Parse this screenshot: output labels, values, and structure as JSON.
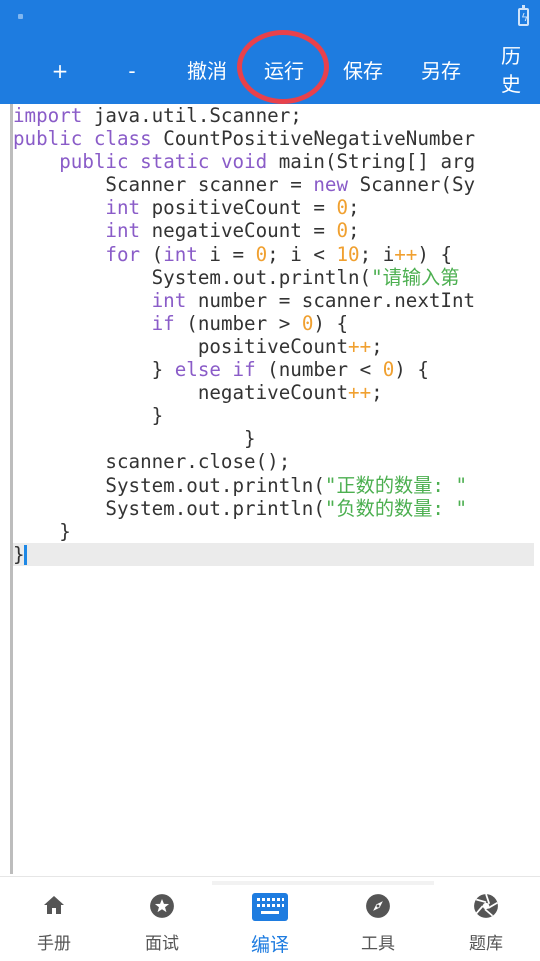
{
  "toolbar": {
    "add_label": "+",
    "remove_label": "-",
    "undo_label": "撤消",
    "run_label": "运行",
    "save_label": "保存",
    "save_as_label": "另存",
    "history_line1": "历",
    "history_line2": "史"
  },
  "editor": {
    "code_lines": [
      "import java.util.Scanner;",
      "public class CountPositiveNegativeNumber",
      "    public static void main(String[] arg",
      "        Scanner scanner = new Scanner(Sy",
      "        int positiveCount = 0;",
      "        int negativeCount = 0;",
      "        for (int i = 0; i < 10; i++) {",
      "            System.out.println(\"请输入第",
      "            int number = scanner.nextInt",
      "            if (number > 0) {",
      "                positiveCount++;",
      "            } else if (number < 0) {",
      "                negativeCount++;",
      "            }",
      "                    }",
      "        scanner.close();",
      "        System.out.println(\"正数的数量: \"",
      "        System.out.println(\"负数的数量: \"",
      "    }",
      "}"
    ]
  },
  "nav": {
    "items": [
      {
        "label": "手册",
        "icon": "home-icon"
      },
      {
        "label": "面试",
        "icon": "star-icon"
      },
      {
        "label": "编译",
        "icon": "keyboard-icon"
      },
      {
        "label": "工具",
        "icon": "compass-icon"
      },
      {
        "label": "题库",
        "icon": "aperture-icon"
      }
    ],
    "active_index": 2
  },
  "colors": {
    "accent": "#1e7ce0",
    "keyword": "#8a5cc8",
    "number": "#f0a030",
    "string": "#4caf50",
    "highlight_ring": "#e8414b"
  }
}
